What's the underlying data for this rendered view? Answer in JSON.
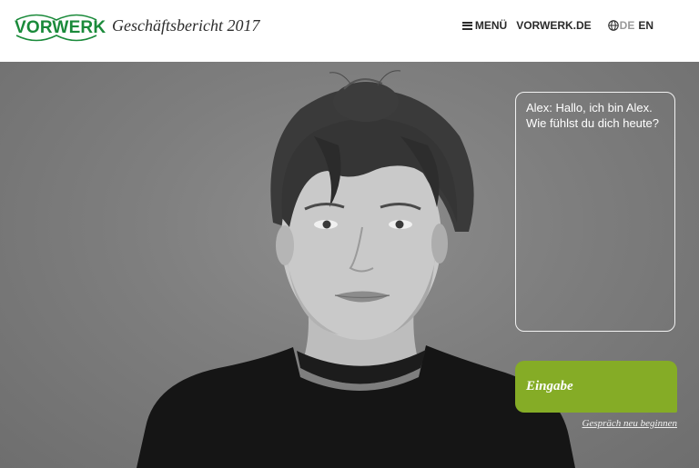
{
  "header": {
    "logo_text": "VORWERK",
    "report_title": "Geschäftsbericht 2017",
    "nav": {
      "menu_label": "MENÜ",
      "site_link": "VORWERK.DE",
      "lang_de": "DE",
      "lang_en": "EN"
    }
  },
  "chat": {
    "messages": [
      {
        "speaker": "Alex",
        "text": "Alex: Hallo, ich bin Alex. Wie fühlst du dich heute?"
      }
    ],
    "input_label": "Eingabe",
    "restart_label": "Gespräch neu beginnen"
  },
  "colors": {
    "brand_green": "#1a8a3a",
    "accent_green": "#85ac26",
    "hero_gray": "#808080"
  },
  "icons": {
    "menu": "hamburger-icon",
    "language": "globe-icon"
  }
}
